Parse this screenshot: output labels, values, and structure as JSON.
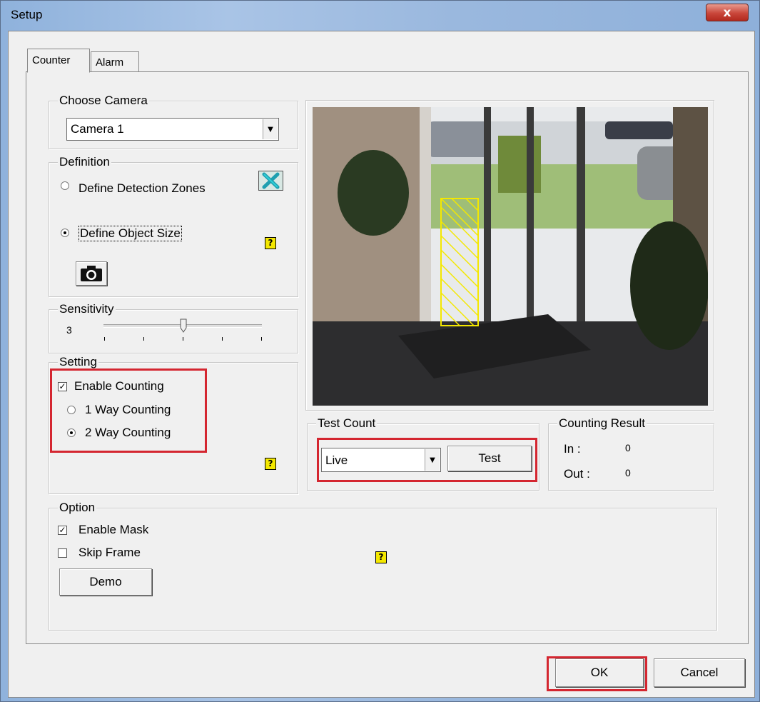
{
  "window": {
    "title": "Setup",
    "close_label": "x"
  },
  "tabs": [
    {
      "label": "Counter",
      "selected": true
    },
    {
      "label": "Alarm",
      "selected": false
    }
  ],
  "choose_camera": {
    "group_label": "Choose Camera",
    "selected": "Camera 1"
  },
  "definition": {
    "group_label": "Definition",
    "options": [
      {
        "label": "Define Detection Zones",
        "selected": false
      },
      {
        "label": "Define Object Size",
        "selected": true
      }
    ],
    "clear_icon": "clear-zones-icon",
    "snapshot_icon": "camera-snapshot-icon"
  },
  "sensitivity": {
    "group_label": "Sensitivity",
    "value": "3"
  },
  "setting": {
    "group_label": "Setting",
    "enable_counting_label": "Enable Counting",
    "enable_counting_checked": true,
    "modes": [
      {
        "label": "1 Way Counting",
        "selected": false
      },
      {
        "label": "2 Way Counting",
        "selected": true
      }
    ]
  },
  "test_count": {
    "group_label": "Test Count",
    "source": "Live",
    "test_label": "Test"
  },
  "counting_result": {
    "group_label": "Counting Result",
    "in_label": "In :",
    "in_value": "0",
    "out_label": "Out :",
    "out_value": "0"
  },
  "option": {
    "group_label": "Option",
    "enable_mask_label": "Enable Mask",
    "enable_mask_checked": true,
    "skip_frame_label": "Skip Frame",
    "skip_frame_checked": false,
    "demo_label": "Demo"
  },
  "help_glyph": "?",
  "footer": {
    "ok_label": "OK",
    "cancel_label": "Cancel"
  },
  "colors": {
    "highlight": "#d42630",
    "zone": "#f4e800"
  }
}
